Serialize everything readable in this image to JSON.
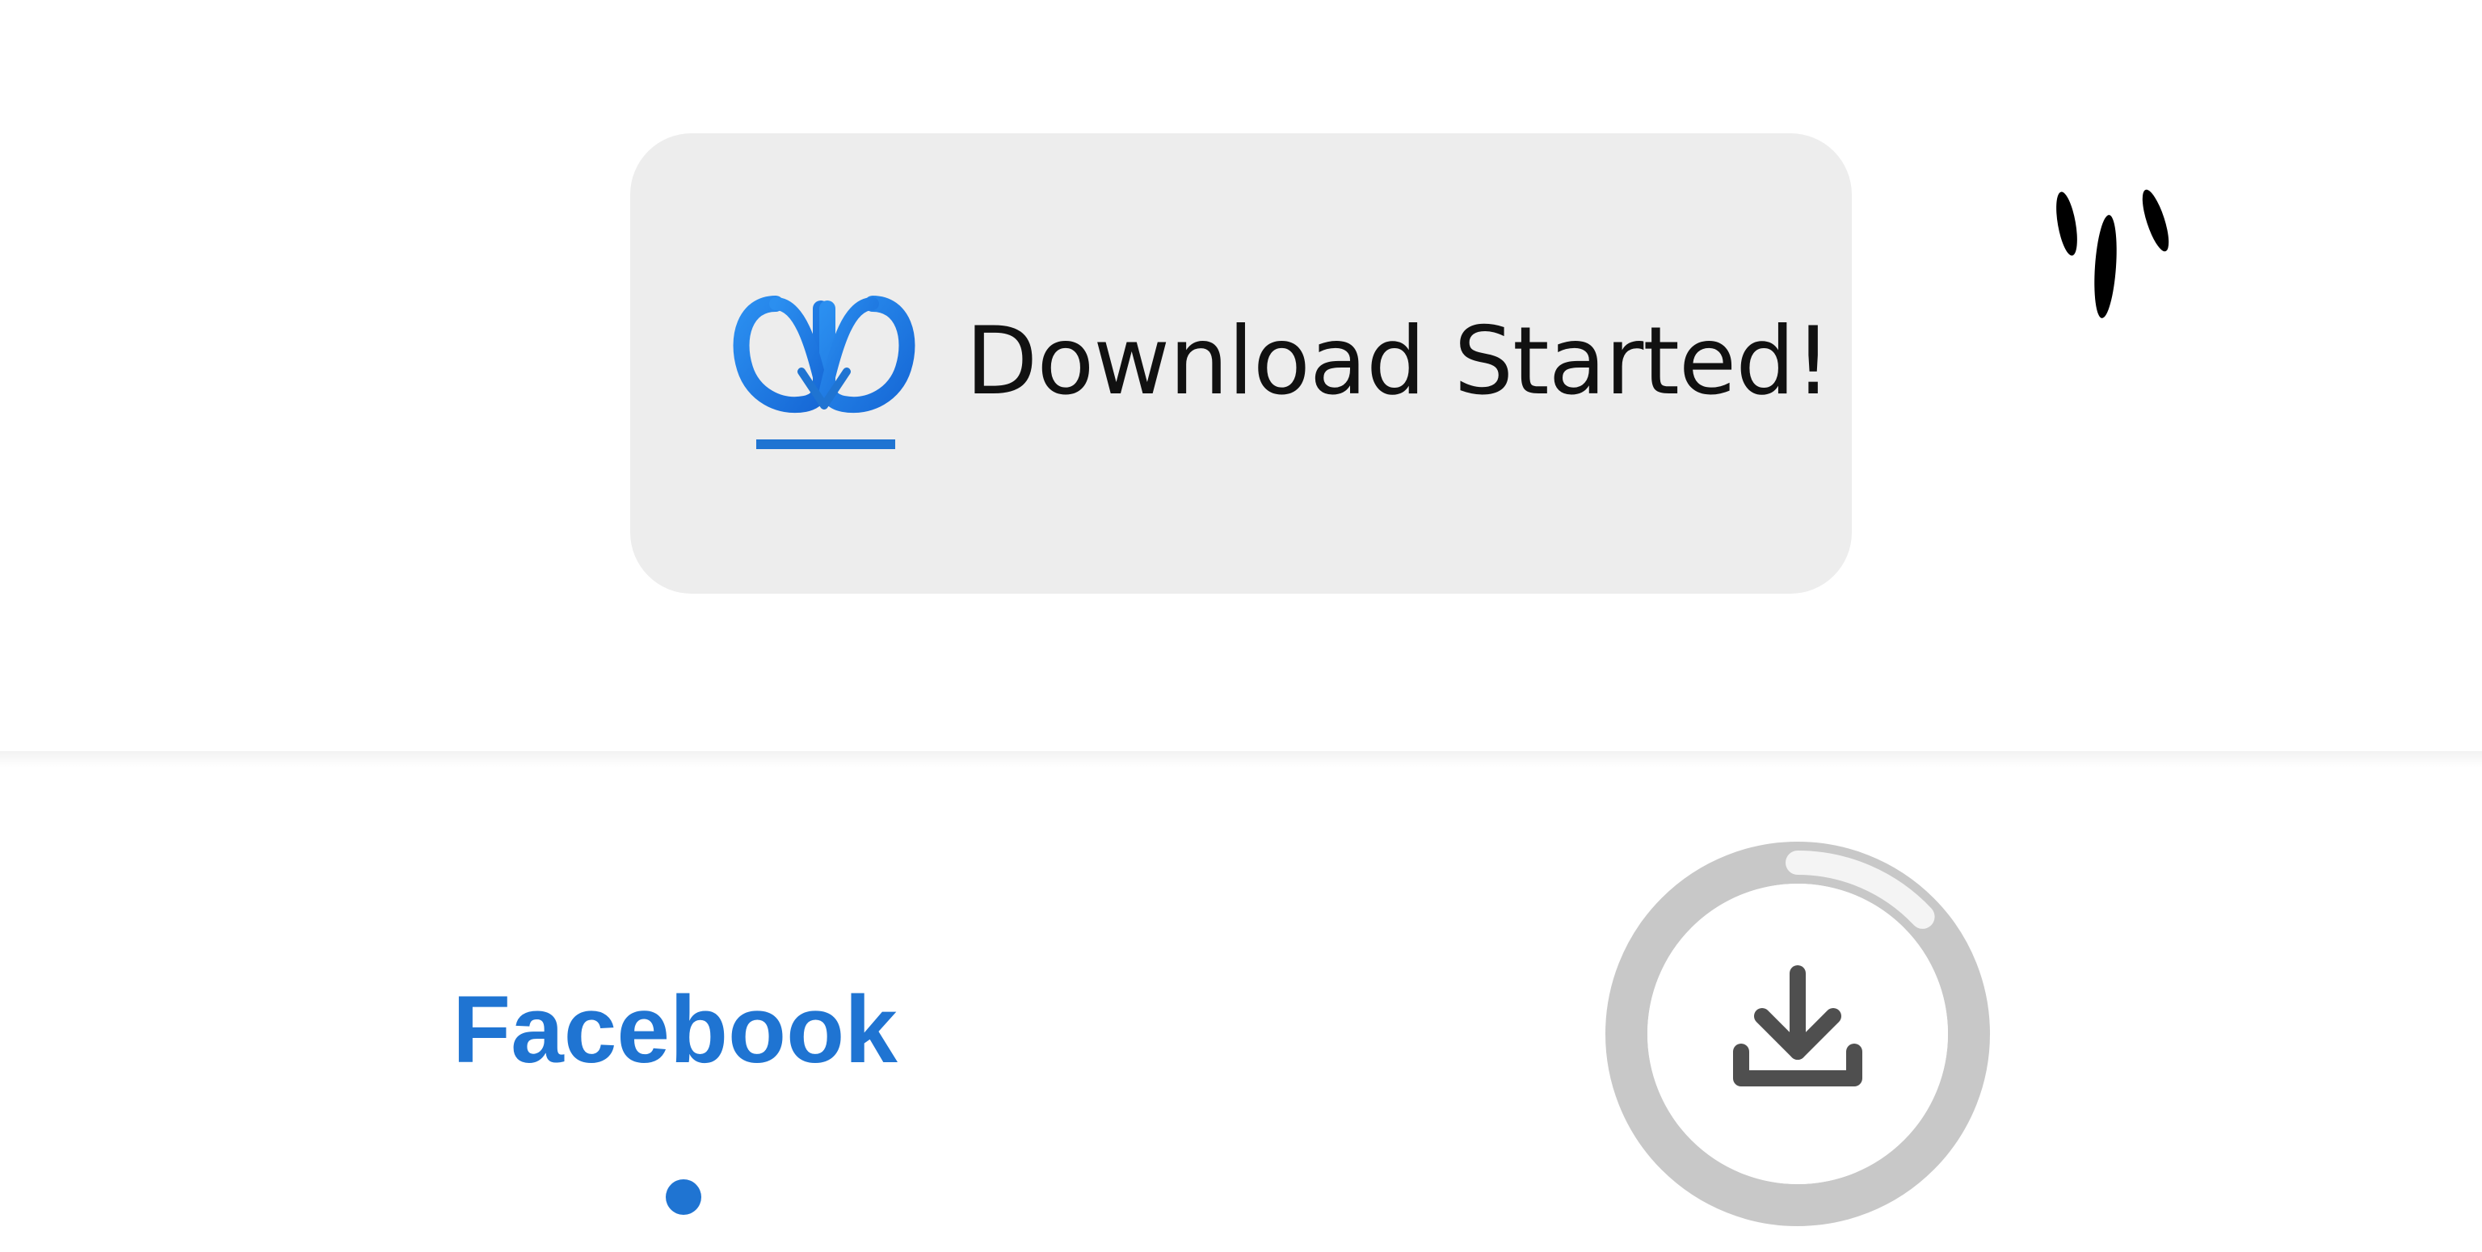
{
  "toast": {
    "message": "Download Started!",
    "logo_icon": "infinity-download-icon",
    "background_color": "#ededed",
    "brand_color": "#1f74d2"
  },
  "decorations": {
    "tap_marks_icon": "tap-marks-icon"
  },
  "bottom_bar": {
    "tab_label": "Facebook",
    "tab_color": "#1f74d2",
    "download_button": {
      "icon": "download-icon",
      "progress": 0.13,
      "ring_track_color": "#c8c8c8",
      "ring_progress_color": "#f4f4f4"
    }
  }
}
